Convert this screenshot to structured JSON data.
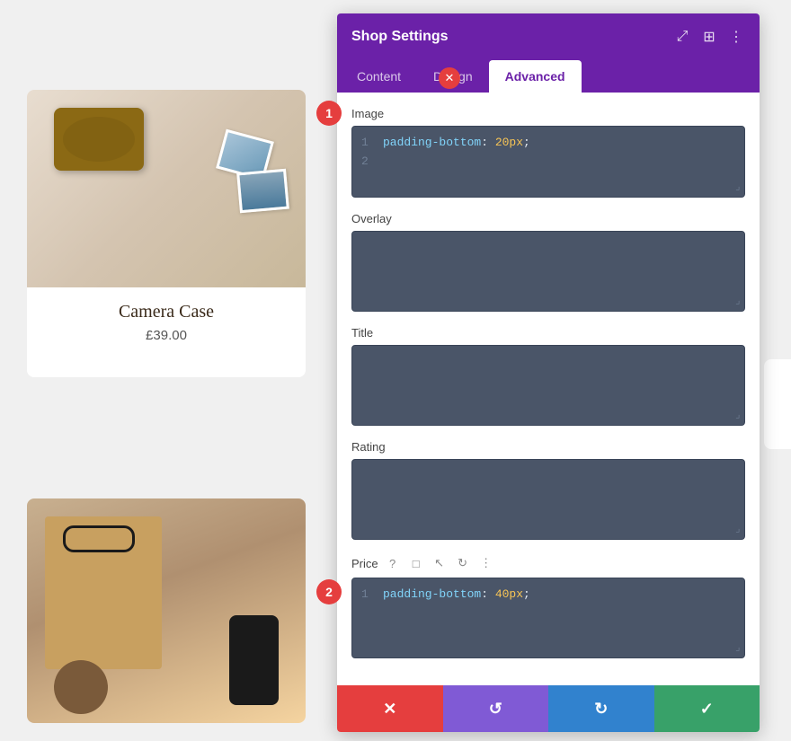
{
  "page": {
    "background_color": "#e8e8e8"
  },
  "panel": {
    "title": "Shop Settings",
    "tabs": [
      {
        "label": "Content",
        "active": false
      },
      {
        "label": "Design",
        "active": false
      },
      {
        "label": "Advanced",
        "active": true
      }
    ],
    "header_icons": {
      "resize_icon": "⤢",
      "grid_icon": "⊞",
      "more_icon": "⋮"
    },
    "sections": [
      {
        "id": "image",
        "label": "Image",
        "step_badge": "1",
        "code_lines": [
          {
            "num": "1",
            "key": "padding-bottom",
            "value": "20px",
            "semi": ";"
          },
          {
            "num": "2",
            "key": "",
            "value": "",
            "semi": ""
          }
        ]
      },
      {
        "id": "overlay",
        "label": "Overlay",
        "code_lines": []
      },
      {
        "id": "title",
        "label": "Title",
        "code_lines": []
      },
      {
        "id": "rating",
        "label": "Rating",
        "code_lines": []
      },
      {
        "id": "price",
        "label": "Price",
        "step_badge": "2",
        "tool_icons": [
          "?",
          "□",
          "↖",
          "↺",
          "⋮"
        ],
        "code_lines": [
          {
            "num": "1",
            "key": "padding-bottom",
            "value": "40px",
            "semi": ";"
          }
        ]
      }
    ],
    "footer": {
      "cancel_icon": "✕",
      "undo_icon": "↺",
      "redo_icon": "↻",
      "save_icon": "✓"
    }
  },
  "product1": {
    "title": "Camera Case",
    "price": "£39.00"
  },
  "badges": {
    "badge1_label": "1",
    "badge2_label": "2"
  }
}
